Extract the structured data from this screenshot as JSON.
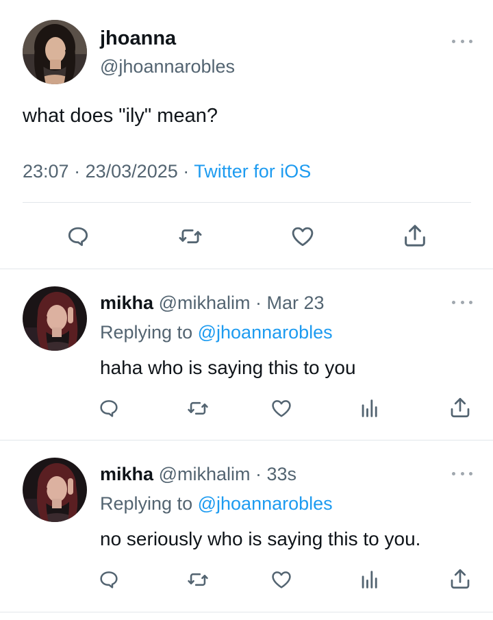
{
  "main_tweet": {
    "name": "jhoanna",
    "handle": "@jhoannarobles",
    "text": "what does \"ily\" mean?",
    "time": "23:07",
    "date": "23/03/2025",
    "separator": "·",
    "source": "Twitter for iOS"
  },
  "replies": [
    {
      "name": "mikha",
      "handle": "@mikhalim",
      "separator": "·",
      "time": "Mar 23",
      "replying_label": "Replying to",
      "replying_to": "@jhoannarobles",
      "text": "haha who is saying this to you"
    },
    {
      "name": "mikha",
      "handle": "@mikhalim",
      "separator": "·",
      "time": "33s",
      "replying_label": "Replying to",
      "replying_to": "@jhoannarobles",
      "text": "no seriously who is saying this to you."
    }
  ],
  "icons": {
    "reply": "reply-icon",
    "retweet": "retweet-icon",
    "like": "heart-icon",
    "views": "analytics-icon",
    "share": "share-icon",
    "more": "more-icon"
  },
  "colors": {
    "text": "#0f1419",
    "secondary": "#536471",
    "accent": "#1d9bf0",
    "icon": "#536471",
    "divider": "#e2e6ea"
  }
}
